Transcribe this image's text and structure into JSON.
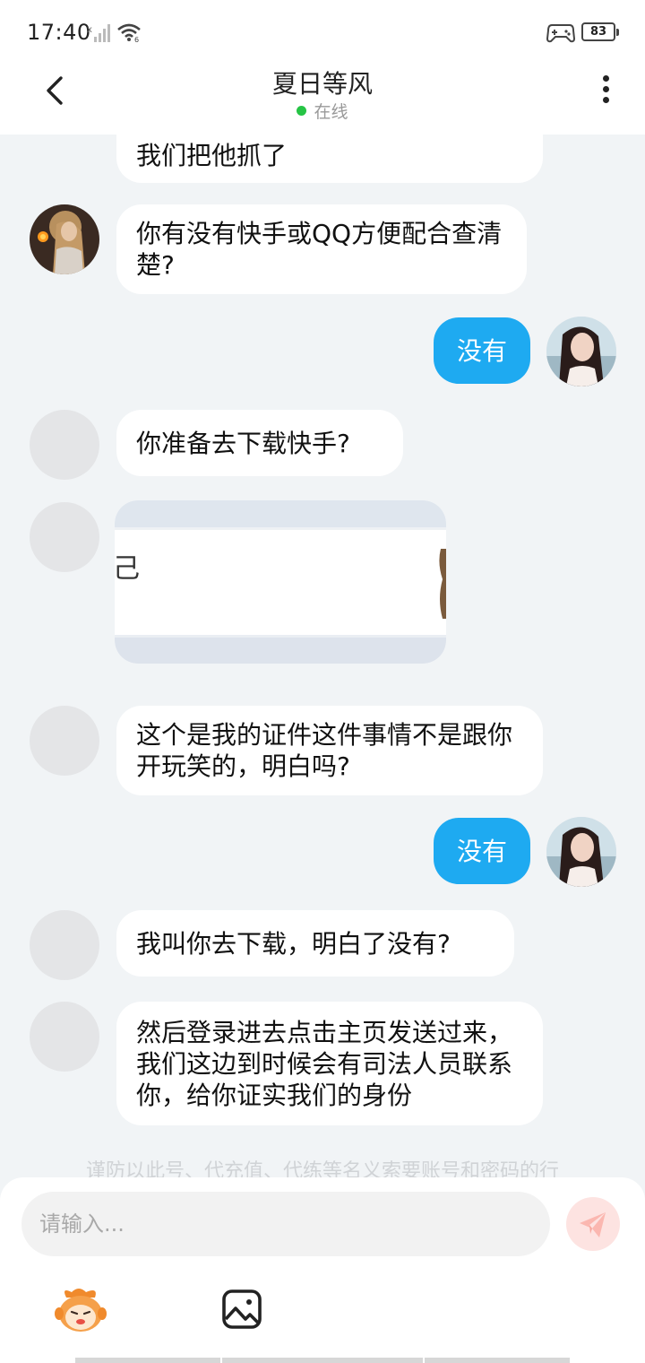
{
  "status_bar": {
    "time": "17:40",
    "battery": "83"
  },
  "header": {
    "title": "夏日等风",
    "status": "在线"
  },
  "messages": [
    {
      "side": "left",
      "text": "我们把他抓了"
    },
    {
      "side": "left",
      "text": "你有没有快手或QQ方便配合查清楚?"
    },
    {
      "side": "right",
      "text": "没有"
    },
    {
      "side": "left",
      "text": "你准备去下载快手?"
    },
    {
      "side": "left",
      "type": "image",
      "text": ""
    },
    {
      "side": "left",
      "text": "这个是我的证件这件事情不是跟你开玩笑的，明白吗?"
    },
    {
      "side": "right",
      "text": "没有"
    },
    {
      "side": "left",
      "text": "我叫你去下载，明白了没有?"
    },
    {
      "side": "left",
      "text": "然后登录进去点击主页发送过来，我们这边到时候会有司法人员联系你，给你证实我们的身份"
    }
  ],
  "notice": "谨防以此号、代充值、代练等名义索要账号和密码的行",
  "composer": {
    "placeholder": "请输入..."
  },
  "icons": [
    "back-arrow-icon",
    "more-vertical-icon",
    "send-icon",
    "emoji-icon",
    "image-icon",
    "signal-icon",
    "wifi-icon",
    "game-icon"
  ],
  "colors": {
    "my_bubble": "#1eaaf1",
    "online_dot": "#26c445",
    "send_button": "#fde3e1"
  }
}
